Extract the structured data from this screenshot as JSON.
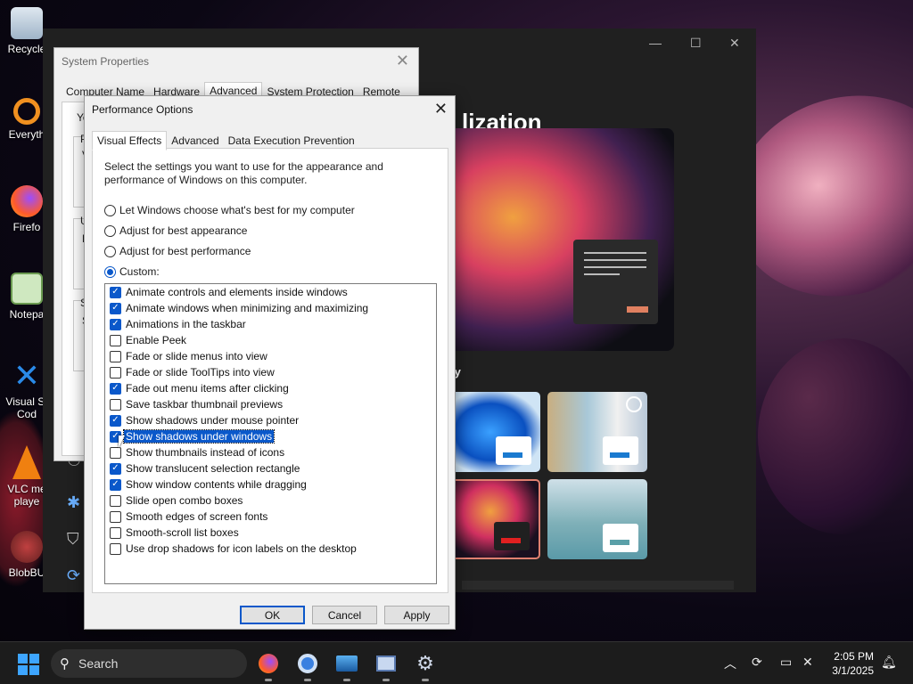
{
  "desktop": {
    "icons": [
      {
        "label": "Recycle",
        "icon": "recycle-bin-icon"
      },
      {
        "label": "Everyth",
        "icon": "everything-search-icon"
      },
      {
        "label": "Firefo",
        "icon": "firefox-icon"
      },
      {
        "label": "Notepa",
        "icon": "notepad-icon"
      },
      {
        "label": "Visual St",
        "label2": "Cod",
        "icon": "vscode-icon"
      },
      {
        "label": "VLC me",
        "label2": "playe",
        "icon": "vlc-icon"
      },
      {
        "label": "BlobBU",
        "icon": "blobbu-icon"
      }
    ]
  },
  "settings": {
    "heading_fragment": "lization",
    "apply_fragment": "ly"
  },
  "system_properties": {
    "title": "System Properties",
    "tabs": [
      "Computer Name",
      "Hardware",
      "Advanced",
      "System Protection",
      "Remote"
    ],
    "active_tab": "Advanced",
    "fragments": [
      "Yo",
      "P",
      "V",
      "U",
      "D",
      "S",
      "S"
    ]
  },
  "performance": {
    "title": "Performance Options",
    "tabs": [
      "Visual Effects",
      "Advanced",
      "Data Execution Prevention"
    ],
    "description": "Select the settings you want to use for the appearance and performance of Windows on this computer.",
    "radios": [
      {
        "label": "Let Windows choose what's best for my computer",
        "checked": false
      },
      {
        "label": "Adjust for best appearance",
        "checked": false
      },
      {
        "label": "Adjust for best performance",
        "checked": false
      },
      {
        "label": "Custom:",
        "checked": true
      }
    ],
    "options": [
      {
        "label": "Animate controls and elements inside windows",
        "checked": true
      },
      {
        "label": "Animate windows when minimizing and maximizing",
        "checked": true
      },
      {
        "label": "Animations in the taskbar",
        "checked": true
      },
      {
        "label": "Enable Peek",
        "checked": false
      },
      {
        "label": "Fade or slide menus into view",
        "checked": false
      },
      {
        "label": "Fade or slide ToolTips into view",
        "checked": false
      },
      {
        "label": "Fade out menu items after clicking",
        "checked": true
      },
      {
        "label": "Save taskbar thumbnail previews",
        "checked": false
      },
      {
        "label": "Show shadows under mouse pointer",
        "checked": true
      },
      {
        "label": "Show shadows under windows",
        "checked": true,
        "selected": true
      },
      {
        "label": "Show thumbnails instead of icons",
        "checked": false
      },
      {
        "label": "Show translucent selection rectangle",
        "checked": true
      },
      {
        "label": "Show window contents while dragging",
        "checked": true
      },
      {
        "label": "Slide open combo boxes",
        "checked": false
      },
      {
        "label": "Smooth edges of screen fonts",
        "checked": false
      },
      {
        "label": "Smooth-scroll list boxes",
        "checked": false
      },
      {
        "label": "Use drop shadows for icon labels on the desktop",
        "checked": false
      }
    ],
    "buttons": {
      "ok": "OK",
      "cancel": "Cancel",
      "apply": "Apply"
    }
  },
  "taskbar": {
    "search_placeholder": "Search",
    "apps": [
      "firefox-icon",
      "chrome-icon",
      "photos-icon",
      "remote-desktop-icon",
      "settings-gear-icon"
    ],
    "time": "2:05 PM",
    "date": "3/1/2025"
  },
  "colors": {
    "accent": "#0a58ca",
    "taskbar": "#1c1c1c",
    "dialog_bg": "#f0f0f0"
  }
}
